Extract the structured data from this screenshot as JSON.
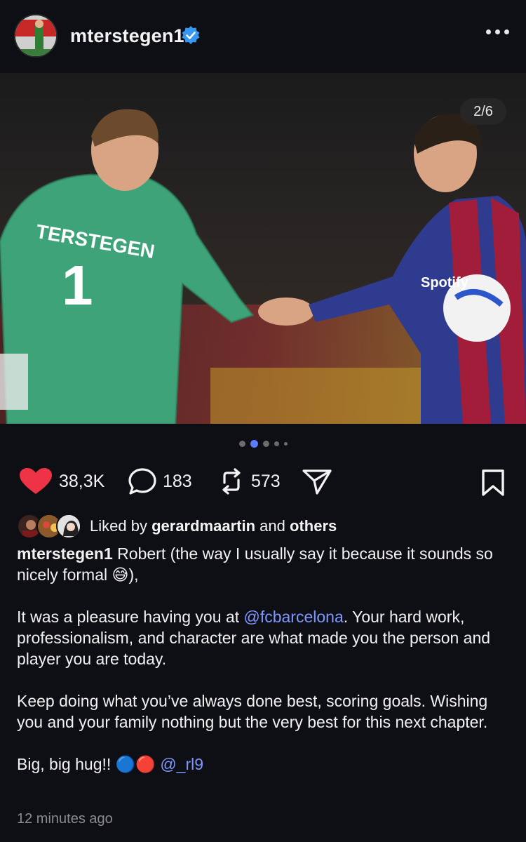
{
  "post": {
    "username": "mterstegen1",
    "more_label": "More options",
    "image_counter": "2/6",
    "carousel": {
      "count": 6,
      "active_index": 1
    }
  },
  "actions": {
    "likes": "38,3K",
    "comments": "183",
    "reposts": "573",
    "like_color": "#ef3346"
  },
  "liked_by": {
    "prefix": "Liked by",
    "user": "gerardmaartin",
    "joiner": "and",
    "suffix": "others"
  },
  "caption": {
    "author": "mterstegen1",
    "line1": "Robert (the way I usually say it because it sounds so nicely formal ",
    "emoji1": "😅",
    "line1_end": "),",
    "p2_before": "It was a pleasure having you at ",
    "p2_mention": "@fcbarcelona",
    "p2_after": ". Your hard work, professionalism, and character are what made you the person and player you are today.",
    "p3": "Keep doing what you’ve always done best, scoring goals. Wishing you and your family nothing but the very best for this next chapter.",
    "p4": "Big, big hug!! ",
    "p4_emoji": "🔵🔴",
    "p4_mention": "@_rl9"
  },
  "timestamp": "12 minutes ago",
  "colors": {
    "mention": "#7f98ff",
    "verified": "#3897f0",
    "background": "#0e0f14"
  }
}
